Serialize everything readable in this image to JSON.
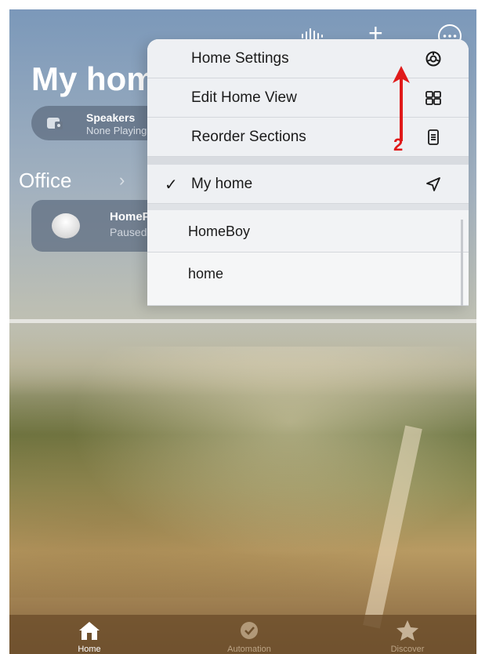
{
  "header": {
    "title": "My home",
    "icons": [
      "waveform-icon",
      "plus-icon",
      "more-icon"
    ]
  },
  "speakers": {
    "title": "Speakers",
    "status": "None Playing"
  },
  "section": {
    "name": "Office"
  },
  "accessory": {
    "name": "HomePod",
    "status": "Paused"
  },
  "menu": {
    "actions": [
      {
        "label": "Home Settings",
        "icon": "gear-icon"
      },
      {
        "label": "Edit Home View",
        "icon": "grid-icon"
      },
      {
        "label": "Reorder Sections",
        "icon": "list-icon"
      }
    ],
    "homes": [
      {
        "label": "My home",
        "selected": true,
        "icon": "location-arrow-icon"
      },
      {
        "label": "HomeBoy",
        "selected": false
      },
      {
        "label": "home",
        "selected": false
      }
    ]
  },
  "annotation": {
    "number": "2",
    "color": "#e01a1a"
  },
  "tabs": [
    {
      "label": "Home",
      "icon": "house-icon",
      "active": true
    },
    {
      "label": "Automation",
      "icon": "automation-icon",
      "active": false
    },
    {
      "label": "Discover",
      "icon": "star-icon",
      "active": false
    }
  ]
}
